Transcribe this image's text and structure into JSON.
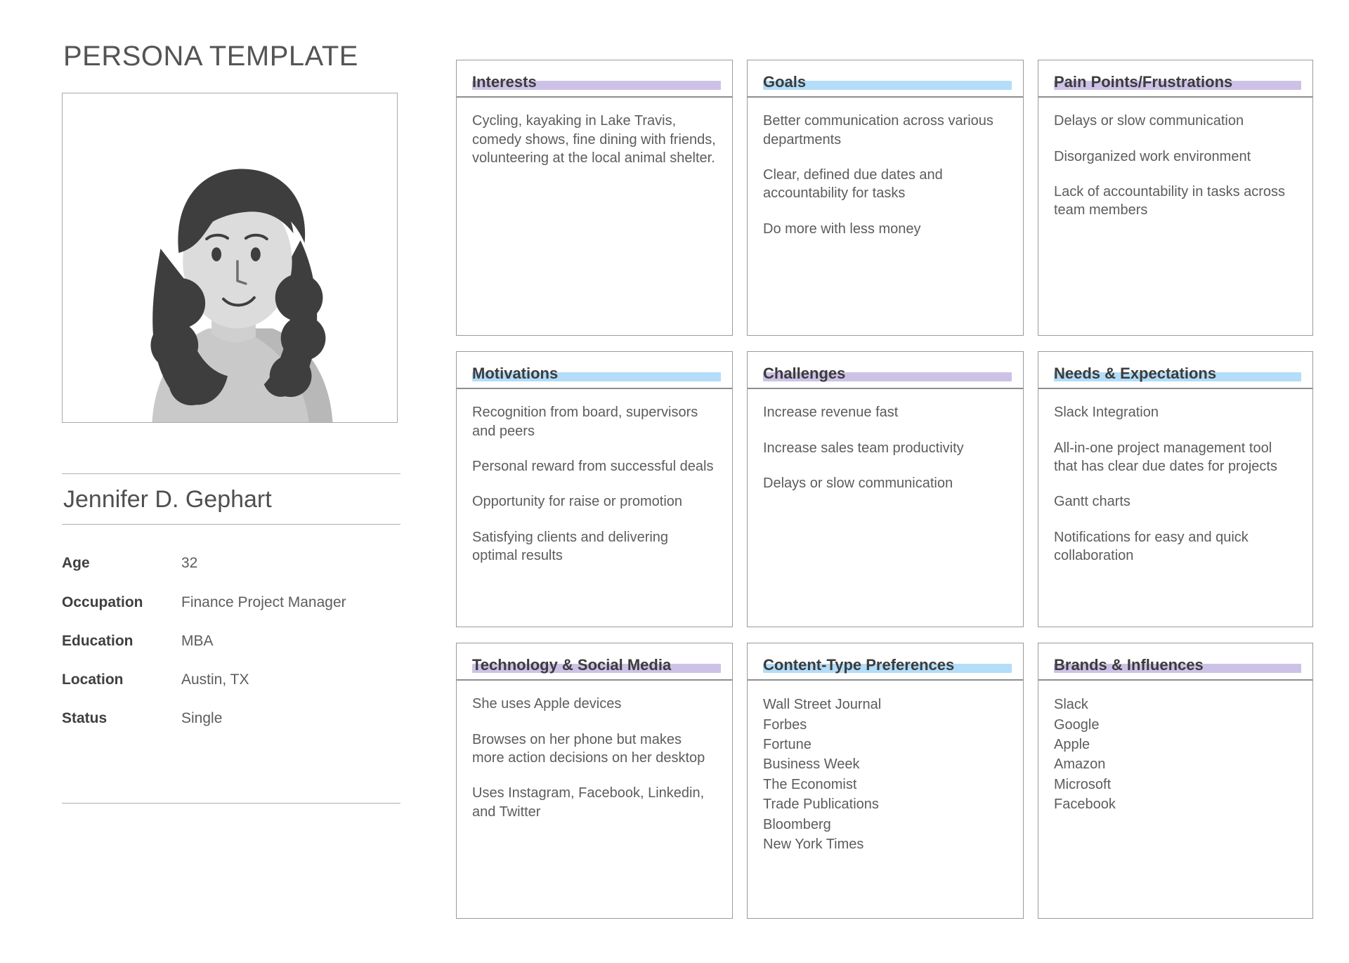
{
  "page_title": "PERSONA TEMPLATE",
  "profile": {
    "name": "Jennifer D. Gephart",
    "attributes": [
      {
        "key": "Age",
        "value": "32"
      },
      {
        "key": "Occupation",
        "value": "Finance Project Manager"
      },
      {
        "key": "Education",
        "value": "MBA"
      },
      {
        "key": "Location",
        "value": "Austin, TX"
      },
      {
        "key": "Status",
        "value": "Single"
      }
    ]
  },
  "colors": {
    "highlight_purple": "#cdc2e6",
    "highlight_blue": "#b3ddf8",
    "card_border": "#9a9a9a",
    "title_text": "#3c3c3c",
    "body_text": "#5c5c5c"
  },
  "cards": [
    {
      "title": "Interests",
      "highlight": "purple",
      "tight": false,
      "items": [
        "Cycling, kayaking in Lake Travis, comedy shows, fine dining with friends, volunteering at the local animal shelter."
      ]
    },
    {
      "title": "Goals",
      "highlight": "blue",
      "tight": false,
      "items": [
        "Better communication across various departments",
        "Clear, defined due dates and accountability for tasks",
        "Do more with less money"
      ]
    },
    {
      "title": "Pain Points/Frustrations",
      "highlight": "purple",
      "tight": false,
      "items": [
        "Delays or slow communication",
        "Disorganized work environment",
        "Lack of accountability in tasks across team members"
      ]
    },
    {
      "title": "Motivations",
      "highlight": "blue",
      "tight": false,
      "items": [
        "Recognition from board, supervisors and peers",
        "Personal reward from successful deals",
        "Opportunity for raise or promotion",
        "Satisfying clients and delivering optimal results"
      ]
    },
    {
      "title": "Challenges",
      "highlight": "purple",
      "tight": false,
      "items": [
        "Increase revenue fast",
        "Increase sales team productivity",
        "Delays or slow communication"
      ]
    },
    {
      "title": "Needs & Expectations",
      "highlight": "blue",
      "tight": false,
      "items": [
        "Slack Integration",
        "All-in-one project management tool that has clear due dates for projects",
        "Gantt charts",
        "Notifications for easy and quick collaboration"
      ]
    },
    {
      "title": "Technology & Social Media",
      "highlight": "purple",
      "tight": false,
      "items": [
        "She uses Apple devices",
        "Browses on her phone but makes more action decisions on her desktop",
        "Uses Instagram, Facebook, Linkedin, and Twitter"
      ]
    },
    {
      "title": "Content-Type Preferences",
      "highlight": "blue",
      "tight": true,
      "items": [
        "Wall Street Journal",
        "Forbes",
        "Fortune",
        "Business Week",
        "The Economist",
        "Trade Publications",
        "Bloomberg",
        "New York Times"
      ]
    },
    {
      "title": "Brands & Influences",
      "highlight": "purple",
      "tight": true,
      "items": [
        "Slack",
        "Google",
        "Apple",
        "Amazon",
        "Microsoft",
        "Facebook"
      ]
    }
  ]
}
